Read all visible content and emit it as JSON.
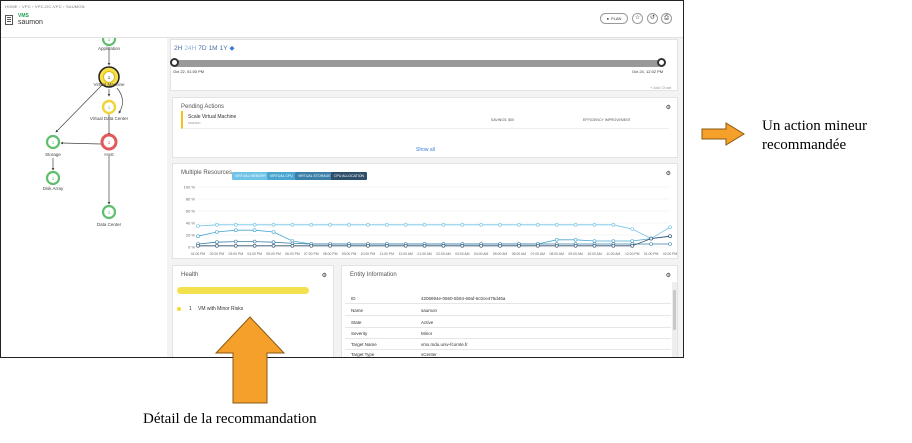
{
  "breadcrumb": "HOME › VPC › VPC-DC-VPC › SAUMON",
  "entity": {
    "type": "VMS",
    "name": "saumon"
  },
  "header": {
    "plan_label": "PLAN",
    "star_icon": "☆",
    "undo_icon": "↺",
    "print_icon": "⎙"
  },
  "supply_chain": {
    "nodes": [
      {
        "label": "Application",
        "count": "1",
        "status": "green"
      },
      {
        "label": "Virtual Machine",
        "count": "1",
        "status": "yellow"
      },
      {
        "label": "Virtual Data Center",
        "count": "1",
        "status": "yellow"
      },
      {
        "label": "Host",
        "count": "1",
        "status": "red"
      },
      {
        "label": "Storage",
        "count": "1",
        "status": "green"
      },
      {
        "label": "Disk Array",
        "count": "1",
        "status": "green"
      },
      {
        "label": "Data Center",
        "count": "1",
        "status": "green"
      }
    ]
  },
  "timeline": {
    "ranges": [
      "2H",
      "24H",
      "7D",
      "1M",
      "1Y"
    ],
    "active_range": "24H",
    "start_label": "Oct 22, 01:00 PM",
    "end_label": "Oct 24, 12:02 PM",
    "add_chart": "+ Add Chart"
  },
  "pending_actions": {
    "title": "Pending Actions",
    "action": "Scale Virtual Machine",
    "target": "saumon",
    "savings": "SAVINGS: $00",
    "improvement": "EFFICIENCY IMPROVEMENT",
    "show_all": "Show all"
  },
  "resources": {
    "title": "Multiple Resources",
    "legend": [
      "VIRTUAL MEMORY",
      "VIRTUAL CPU",
      "VIRTUAL STORAGE",
      "CPU ALLOCATION"
    ],
    "legend_colors": [
      "#6fc3e6",
      "#4aa6d1",
      "#3a7fa8",
      "#2e4f6b"
    ]
  },
  "chart_data": {
    "type": "line",
    "y_ticks": [
      "100 %",
      "80 %",
      "60 %",
      "40 %",
      "20 %",
      "0 %"
    ],
    "ylim": [
      0,
      100
    ],
    "x": [
      "01:00 PM",
      "02:00 PM",
      "03:00 PM",
      "04:00 PM",
      "05:00 PM",
      "06:00 PM",
      "07:00 PM",
      "08:00 PM",
      "09:00 PM",
      "10:00 PM",
      "11:00 PM",
      "12:00 AM",
      "01:00 AM",
      "02:00 AM",
      "03:00 AM",
      "04:00 AM",
      "05:00 AM",
      "06:00 AM",
      "07:00 AM",
      "08:00 AM",
      "09:00 AM",
      "10:00 AM",
      "11:00 AM",
      "12:00 PM",
      "01:00 PM",
      "02:00 PM"
    ],
    "series": [
      {
        "name": "VIRTUAL MEMORY",
        "color": "#6fc3e6",
        "values": [
          35,
          37,
          37,
          37,
          37,
          37,
          37,
          37,
          37,
          37,
          37,
          37,
          37,
          37,
          37,
          37,
          37,
          37,
          37,
          37,
          37,
          37,
          37,
          30,
          14,
          33
        ]
      },
      {
        "name": "VIRTUAL CPU",
        "color": "#4aa6d1",
        "values": [
          18,
          25,
          28,
          28,
          25,
          10,
          5,
          5,
          5,
          5,
          5,
          5,
          5,
          5,
          5,
          5,
          5,
          5,
          5,
          12,
          12,
          10,
          10,
          10,
          14,
          18
        ]
      },
      {
        "name": "VIRTUAL STORAGE",
        "color": "#3a7fa8",
        "values": [
          5,
          8,
          9,
          9,
          8,
          6,
          5,
          5,
          5,
          5,
          5,
          5,
          5,
          5,
          5,
          5,
          5,
          5,
          5,
          5,
          5,
          5,
          5,
          5,
          5,
          5
        ]
      },
      {
        "name": "CPU ALLOCATION",
        "color": "#2e4f6b",
        "values": [
          2,
          2,
          2,
          2,
          2,
          2,
          2,
          2,
          2,
          2,
          2,
          2,
          2,
          2,
          2,
          2,
          2,
          2,
          2,
          2,
          2,
          2,
          2,
          2,
          14,
          18
        ]
      }
    ]
  },
  "health": {
    "title": "Health",
    "count": "1",
    "text": "VM with Minor Risks"
  },
  "entity_info": {
    "title": "Entity Information",
    "rows": [
      {
        "key": "ID",
        "value": "4206694e-0560-5b94-69af-6c0ce475d46a"
      },
      {
        "key": "Name",
        "value": "saumon"
      },
      {
        "key": "State",
        "value": "Active"
      },
      {
        "key": "Severity",
        "value": "Minor"
      },
      {
        "key": "Target Name",
        "value": "vmx.mdu.univ-fcomte.fr"
      },
      {
        "key": "Target Type",
        "value": "vCenter"
      }
    ]
  },
  "annotations": {
    "right": "Un action  mineur recommandée",
    "bottom": "Détail  de la recommandation",
    "arrow_color": "#f5a02a"
  }
}
